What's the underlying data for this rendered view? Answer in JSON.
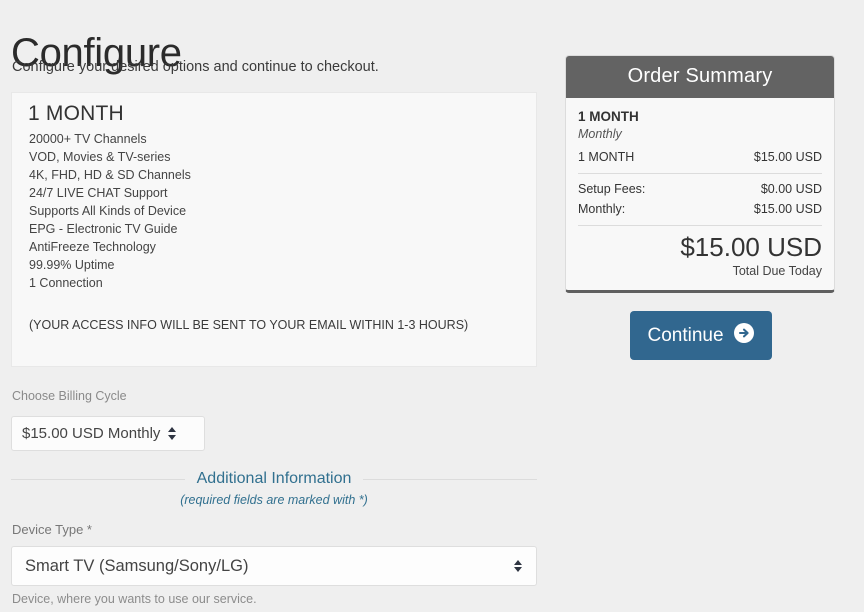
{
  "header": {
    "title": "Configure",
    "subtitle": "Configure your desired options and continue to checkout."
  },
  "product": {
    "name": "1 MONTH",
    "features": [
      "20000+ TV Channels",
      "VOD, Movies & TV-series",
      "4K, FHD, HD & SD Channels",
      "24/7 LIVE CHAT Support",
      "Supports All Kinds of Device",
      "EPG - Electronic TV Guide",
      "AntiFreeze Technology",
      "99.99% Uptime",
      "1 Connection"
    ],
    "access_note": "(YOUR ACCESS INFO WILL BE SENT TO YOUR EMAIL WITHIN 1-3 HOURS)"
  },
  "billing_cycle": {
    "label": "Choose Billing Cycle",
    "selected": "$15.00 USD Monthly"
  },
  "additional_information": {
    "heading": "Additional Information",
    "note": "(required fields are marked with *)",
    "accent_color": "#31708f"
  },
  "device_type": {
    "label": "Device Type *",
    "selected": "Smart TV (Samsung/Sony/LG)",
    "help": "Device, where you wants to use our service."
  },
  "order_summary": {
    "title": "Order Summary",
    "product_name": "1 MONTH",
    "billing_cycle": "Monthly",
    "line_item": {
      "label": "1 MONTH",
      "amount": "$15.00 USD"
    },
    "fees": [
      {
        "label": "Setup Fees:",
        "amount": "$0.00 USD"
      },
      {
        "label": "Monthly:",
        "amount": "$15.00 USD"
      }
    ],
    "total": "$15.00 USD",
    "total_label": "Total Due Today",
    "header_color": "#636363"
  },
  "continue": {
    "label": "Continue",
    "icon": "arrow-circle-right-icon",
    "color": "#31678f"
  }
}
